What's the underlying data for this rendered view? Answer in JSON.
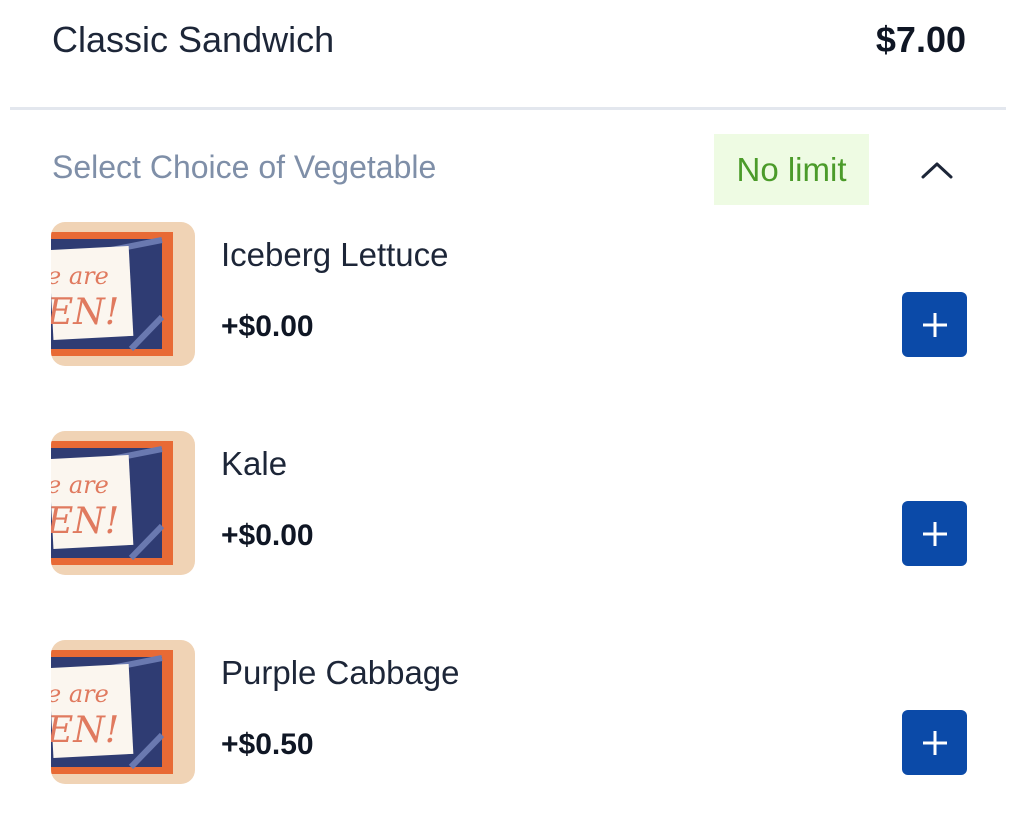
{
  "item": {
    "title": "Classic Sandwich",
    "price": "$7.00"
  },
  "section": {
    "title": "Select Choice of Vegetable",
    "limit_badge": "No limit",
    "collapse_icon": "chevron-up-icon"
  },
  "options": [
    {
      "name": "Iceberg Lettuce",
      "price": "+$0.00",
      "image_text_1": "e are",
      "image_text_2": "EN!"
    },
    {
      "name": "Kale",
      "price": "+$0.00",
      "image_text_1": "e are",
      "image_text_2": "EN!"
    },
    {
      "name": "Purple Cabbage",
      "price": "+$0.50",
      "image_text_1": "e are",
      "image_text_2": "EN!"
    }
  ],
  "colors": {
    "accent": "#0b4aa8",
    "badge_bg": "#eefbe3",
    "badge_text": "#4b9b2a",
    "section_title": "#7f8fa8",
    "divider": "#e3e7ee"
  },
  "icons": {
    "add": "plus-icon"
  }
}
